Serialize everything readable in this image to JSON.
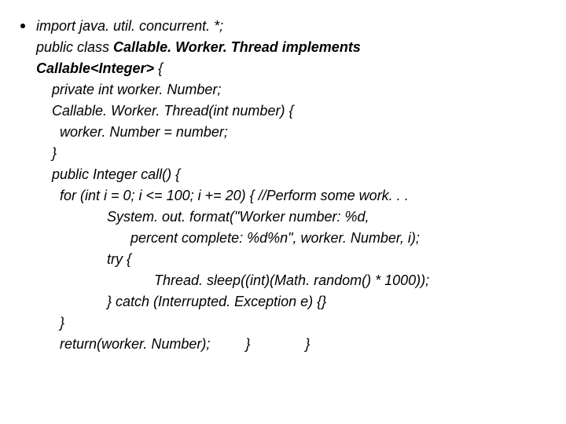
{
  "code": {
    "l1": "import java. util. concurrent. *;",
    "l2a": "public class ",
    "l2b": "Callable. Worker. Thread implements",
    "l3a": "Callable<Integer>",
    "l3b": " {",
    "l4": "private int worker. Number;",
    "l5": "Callable. Worker. Thread(int number) {",
    "l6": "worker. Number = number;",
    "l7": "}",
    "l8": "public Integer call() {",
    "l9": "for (int i = 0; i <= 100; i += 20) { //Perform some work. . .",
    "l10": "System. out. format(\"Worker number: %d,",
    "l11": "percent complete: %d%n\", worker. Number, i);",
    "l12": "try {",
    "l13": "Thread. sleep((int)(Math. random() * 1000));",
    "l14": "} catch (Interrupted. Exception e) {}",
    "l15": "}",
    "l16": "return(worker. Number);         }              }"
  }
}
